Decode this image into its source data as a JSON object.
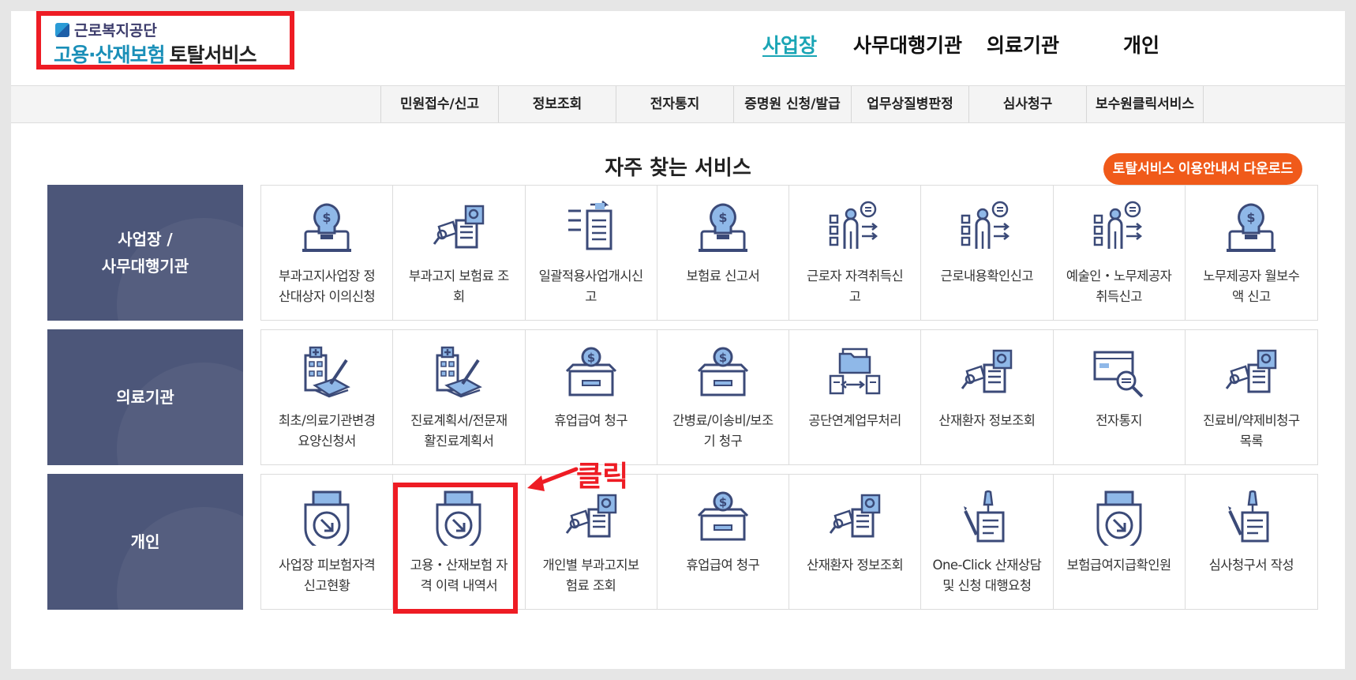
{
  "logo": {
    "org": "근로복지공단",
    "title_a": "고용·산재보험",
    "title_b": "토탈서비스"
  },
  "top_nav": [
    {
      "label": "사업장",
      "active": true
    },
    {
      "label": "사무대행기관",
      "active": false
    },
    {
      "label": "의료기관",
      "active": false
    },
    {
      "label": "개인",
      "active": false
    }
  ],
  "gnb": [
    "민원접수/신고",
    "정보조회",
    "전자통지",
    "증명원 신청/발급",
    "업무상질병판정",
    "심사청구",
    "보수원클릭서비스"
  ],
  "section": {
    "title": "자주 찾는 서비스",
    "guide_button": "토탈서비스 이용안내서 다운로드"
  },
  "rows": [
    {
      "label": "사업장 /\n사무대행기관",
      "items": [
        {
          "label": "부과고지사업장 정\n산대상자 이의신청",
          "icon": "money-bulb-icon"
        },
        {
          "label": "부과고지 보험료 조\n회",
          "icon": "document-search-icon"
        },
        {
          "label": "일괄적용사업개시신\n고",
          "icon": "document-transfer-icon"
        },
        {
          "label": "보험료 신고서",
          "icon": "money-bulb-icon"
        },
        {
          "label": "근로자 자격취득신\n고",
          "icon": "worker-list-icon"
        },
        {
          "label": "근로내용확인신고",
          "icon": "worker-list-icon"
        },
        {
          "label": "예술인・노무제공자\n취득신고",
          "icon": "worker-list-icon"
        },
        {
          "label": "노무제공자 월보수\n액 신고",
          "icon": "money-bulb-icon"
        }
      ]
    },
    {
      "label": "의료기관",
      "items": [
        {
          "label": "최초/의료기관변경\n요양신청서",
          "icon": "hospital-pen-icon"
        },
        {
          "label": "진료계획서/전문재\n활진료계획서",
          "icon": "hospital-pen-icon"
        },
        {
          "label": "휴업급여 청구",
          "icon": "money-box-icon"
        },
        {
          "label": "간병료/이송비/보조\n기 청구",
          "icon": "money-box-icon"
        },
        {
          "label": "공단연계업무처리",
          "icon": "folder-exchange-icon"
        },
        {
          "label": "산재환자 정보조회",
          "icon": "document-search-icon"
        },
        {
          "label": "전자통지",
          "icon": "parcel-search-icon"
        },
        {
          "label": "진료비/약제비청구\n목록",
          "icon": "document-search-icon"
        }
      ]
    },
    {
      "label": "개인",
      "items": [
        {
          "label": "사업장 피보험자격\n신고현황",
          "icon": "print-download-icon"
        },
        {
          "label": "고용・산재보험 자\n격 이력 내역서",
          "icon": "print-download-icon"
        },
        {
          "label": "개인별 부과고지보\n험료 조회",
          "icon": "document-search-icon"
        },
        {
          "label": "휴업급여 청구",
          "icon": "money-box-icon"
        },
        {
          "label": "산재환자 정보조회",
          "icon": "document-search-icon"
        },
        {
          "label": "One-Click 산재상담\n및 신청 대행요청",
          "icon": "pin-document-icon"
        },
        {
          "label": "보험급여지급확인원",
          "icon": "print-download-icon"
        },
        {
          "label": "심사청구서 작성",
          "icon": "pin-document-icon"
        }
      ]
    }
  ],
  "annotation": {
    "click_label": "클릭"
  },
  "colors": {
    "accent": "#1aa5b5",
    "label_bg": "#4c5679",
    "guide_button": "#f05a1a",
    "highlight": "#ee1c24",
    "icon_stroke": "#3b4a78",
    "icon_fill": "#8fb8e8"
  }
}
